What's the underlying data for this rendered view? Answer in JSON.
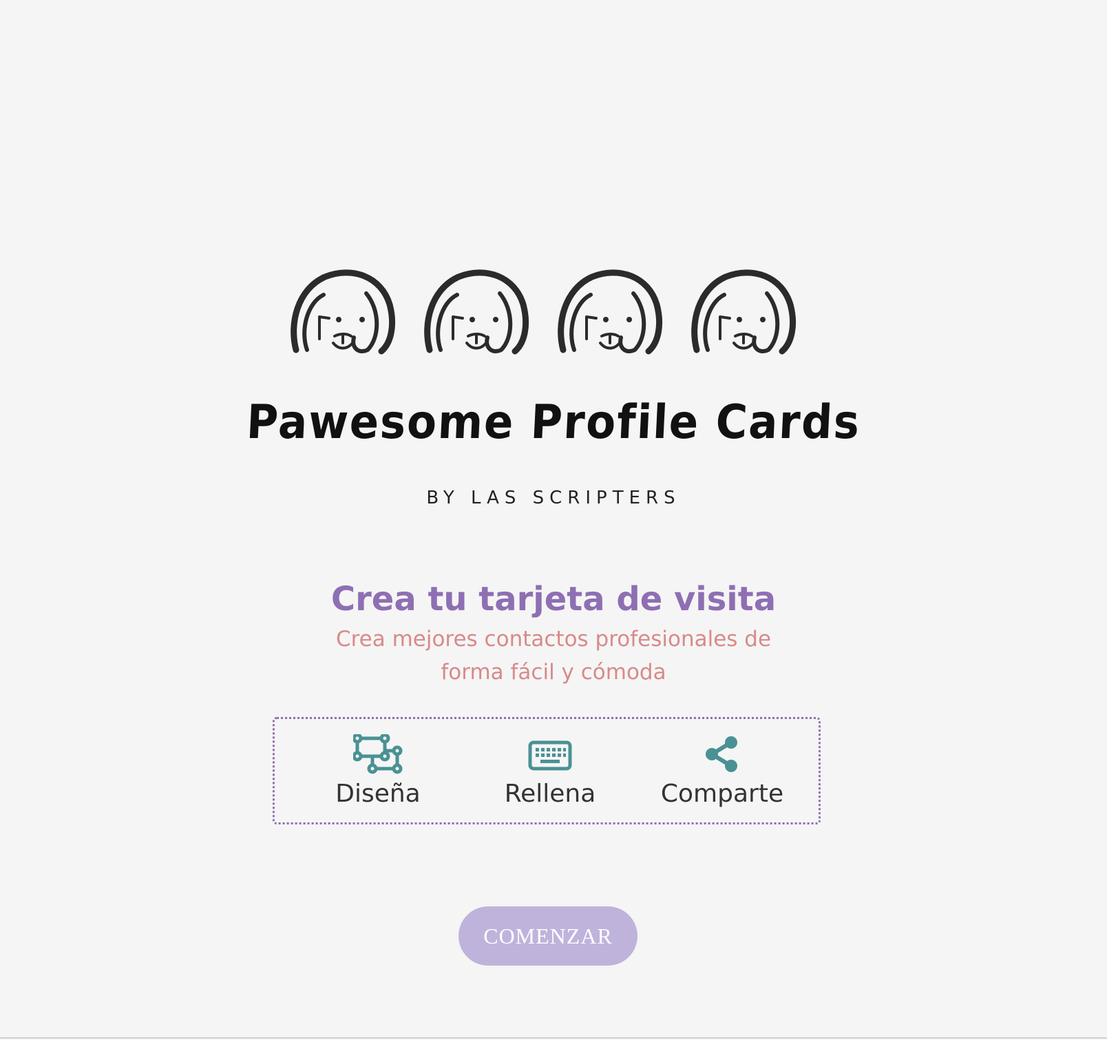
{
  "logo": {
    "title": "Pawesome Profile Cards",
    "subtitle": "BY LAS SCRIPTERS"
  },
  "hero": {
    "heading": "Crea tu tarjeta de visita",
    "subheading": "Crea mejores contactos profesionales de forma fácil y cómoda"
  },
  "steps": [
    {
      "label": "Diseña",
      "icon": "vector-design-icon"
    },
    {
      "label": "Rellena",
      "icon": "keyboard-icon"
    },
    {
      "label": "Comparte",
      "icon": "share-icon"
    }
  ],
  "cta": {
    "label": "COMENZAR"
  },
  "colors": {
    "heading": "#8e6fb3",
    "subheading": "#d88a8a",
    "icons": "#4a9194",
    "button": "#bfb3dc",
    "background": "#f5f5f5"
  }
}
